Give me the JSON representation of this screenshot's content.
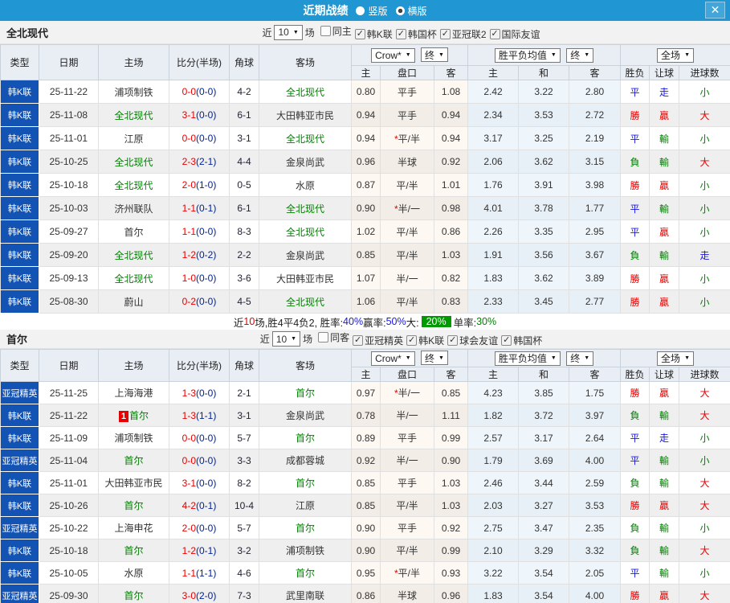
{
  "titlebar": {
    "title": "近期战绩",
    "layout_options": [
      {
        "label": "竖版",
        "selected": false
      },
      {
        "label": "横版",
        "selected": true
      }
    ],
    "close_icon": "✕"
  },
  "colors": {
    "accent_blue": "#2097d3",
    "type_column_blue": "#1353b4",
    "focus_team_green": "#008000",
    "score_red": "#e60000",
    "halftime_navy": "#00239c",
    "badge_green": "#009900"
  },
  "table_header": {
    "type": "类型",
    "date": "日期",
    "home": "主场",
    "score": "比分(半场)",
    "corner": "角球",
    "away": "客场",
    "bookmaker_select": "Crow*",
    "final_select": "终",
    "avg_select": "胜平负均值",
    "final_select2": "终",
    "scope_select": "全场",
    "caret": "▼",
    "sub_headers": [
      "主",
      "盘口",
      "客",
      "主",
      "和",
      "客",
      "胜负",
      "让球",
      "进球数"
    ]
  },
  "result_colors": {
    "勝": "#e60000",
    "贏": "#e60000",
    "大": "#e60000",
    "平": "#1515e6",
    "走": "#1515e6",
    "負": "#008000",
    "輸": "#008000",
    "小": "#008000"
  },
  "sections": [
    {
      "team": "全北现代",
      "filters": {
        "prefix": "近",
        "count": "10",
        "suffix": "场",
        "checkboxes": [
          {
            "label": "同主",
            "checked": false
          },
          {
            "label": "韩K联",
            "checked": true
          },
          {
            "label": "韩国杯",
            "checked": true
          },
          {
            "label": "亚冠联2",
            "checked": true
          },
          {
            "label": "国际友谊",
            "checked": true
          }
        ]
      },
      "rows": [
        {
          "type": "韩K联",
          "date": "25-11-22",
          "home": "浦项制铁",
          "home_focus": false,
          "home_card": "",
          "score": "0-0",
          "half": "(0-0)",
          "corner": "4-2",
          "away": "全北现代",
          "away_focus": true,
          "away_card": "",
          "odds": [
            "0.80",
            "平手",
            "1.08"
          ],
          "star": false,
          "avg": [
            "2.42",
            "3.22",
            "2.80"
          ],
          "results": [
            "平",
            "走",
            "小"
          ]
        },
        {
          "type": "韩K联",
          "date": "25-11-08",
          "home": "全北现代",
          "home_focus": true,
          "home_card": "",
          "score": "3-1",
          "half": "(0-0)",
          "corner": "6-1",
          "away": "大田韩亚市民",
          "away_focus": false,
          "away_card": "",
          "odds": [
            "0.94",
            "平手",
            "0.94"
          ],
          "star": false,
          "avg": [
            "2.34",
            "3.53",
            "2.72"
          ],
          "results": [
            "勝",
            "贏",
            "大"
          ]
        },
        {
          "type": "韩K联",
          "date": "25-11-01",
          "home": "江原",
          "home_focus": false,
          "home_card": "",
          "score": "0-0",
          "half": "(0-0)",
          "corner": "3-1",
          "away": "全北现代",
          "away_focus": true,
          "away_card": "",
          "odds": [
            "0.94",
            "平/半",
            "0.94"
          ],
          "star": true,
          "avg": [
            "3.17",
            "3.25",
            "2.19"
          ],
          "results": [
            "平",
            "輸",
            "小"
          ]
        },
        {
          "type": "韩K联",
          "date": "25-10-25",
          "home": "全北现代",
          "home_focus": true,
          "home_card": "",
          "score": "2-3",
          "half": "(2-1)",
          "corner": "4-4",
          "away": "金泉尚武",
          "away_focus": false,
          "away_card": "",
          "odds": [
            "0.96",
            "半球",
            "0.92"
          ],
          "star": false,
          "avg": [
            "2.06",
            "3.62",
            "3.15"
          ],
          "results": [
            "負",
            "輸",
            "大"
          ]
        },
        {
          "type": "韩K联",
          "date": "25-10-18",
          "home": "全北现代",
          "home_focus": true,
          "home_card": "",
          "score": "2-0",
          "half": "(1-0)",
          "corner": "0-5",
          "away": "水原",
          "away_focus": false,
          "away_card": "",
          "odds": [
            "0.87",
            "平/半",
            "1.01"
          ],
          "star": false,
          "avg": [
            "1.76",
            "3.91",
            "3.98"
          ],
          "results": [
            "勝",
            "贏",
            "小"
          ]
        },
        {
          "type": "韩K联",
          "date": "25-10-03",
          "home": "济州联队",
          "home_focus": false,
          "home_card": "",
          "score": "1-1",
          "half": "(0-1)",
          "corner": "6-1",
          "away": "全北现代",
          "away_focus": true,
          "away_card": "",
          "odds": [
            "0.90",
            "半/一",
            "0.98"
          ],
          "star": true,
          "avg": [
            "4.01",
            "3.78",
            "1.77"
          ],
          "results": [
            "平",
            "輸",
            "小"
          ]
        },
        {
          "type": "韩K联",
          "date": "25-09-27",
          "home": "首尔",
          "home_focus": false,
          "home_card": "",
          "score": "1-1",
          "half": "(0-0)",
          "corner": "8-3",
          "away": "全北现代",
          "away_focus": true,
          "away_card": "",
          "odds": [
            "1.02",
            "平/半",
            "0.86"
          ],
          "star": false,
          "avg": [
            "2.26",
            "3.35",
            "2.95"
          ],
          "results": [
            "平",
            "贏",
            "小"
          ]
        },
        {
          "type": "韩K联",
          "date": "25-09-20",
          "home": "全北现代",
          "home_focus": true,
          "home_card": "",
          "score": "1-2",
          "half": "(0-2)",
          "corner": "2-2",
          "away": "金泉尚武",
          "away_focus": false,
          "away_card": "",
          "odds": [
            "0.85",
            "平/半",
            "1.03"
          ],
          "star": false,
          "avg": [
            "1.91",
            "3.56",
            "3.67"
          ],
          "results": [
            "負",
            "輸",
            "走"
          ]
        },
        {
          "type": "韩K联",
          "date": "25-09-13",
          "home": "全北现代",
          "home_focus": true,
          "home_card": "",
          "score": "1-0",
          "half": "(0-0)",
          "corner": "3-6",
          "away": "大田韩亚市民",
          "away_focus": false,
          "away_card": "",
          "odds": [
            "1.07",
            "半/一",
            "0.82"
          ],
          "star": false,
          "avg": [
            "1.83",
            "3.62",
            "3.89"
          ],
          "results": [
            "勝",
            "贏",
            "小"
          ]
        },
        {
          "type": "韩K联",
          "date": "25-08-30",
          "home": "蔚山",
          "home_focus": false,
          "home_card": "",
          "score": "0-2",
          "half": "(0-0)",
          "corner": "4-5",
          "away": "全北现代",
          "away_focus": true,
          "away_card": "",
          "odds": [
            "1.06",
            "平/半",
            "0.83"
          ],
          "star": false,
          "avg": [
            "2.33",
            "3.45",
            "2.77"
          ],
          "results": [
            "勝",
            "贏",
            "小"
          ]
        }
      ],
      "summary": [
        {
          "t": "近",
          "s": "plain"
        },
        {
          "t": "10",
          "s": "red"
        },
        {
          "t": "场,胜4平4负2, 胜率:",
          "s": "plain"
        },
        {
          "t": "40%",
          "s": "blue"
        },
        {
          "t": " 赢率:",
          "s": "plain"
        },
        {
          "t": "50%",
          "s": "blue"
        },
        {
          "t": " 大:",
          "s": "plain"
        },
        {
          "t": "20%",
          "s": "badge"
        },
        {
          "t": " 单率:",
          "s": "plain"
        },
        {
          "t": "30%",
          "s": "green"
        }
      ]
    },
    {
      "team": "首尔",
      "filters": {
        "prefix": "近",
        "count": "10",
        "suffix": "场",
        "checkboxes": [
          {
            "label": "同客",
            "checked": false
          },
          {
            "label": "亚冠精英",
            "checked": true
          },
          {
            "label": "韩K联",
            "checked": true
          },
          {
            "label": "球会友谊",
            "checked": true
          },
          {
            "label": "韩国杯",
            "checked": true
          }
        ]
      },
      "rows": [
        {
          "type": "亚冠精英",
          "date": "25-11-25",
          "home": "上海海港",
          "home_focus": false,
          "home_card": "",
          "score": "1-3",
          "half": "(0-0)",
          "corner": "2-1",
          "away": "首尔",
          "away_focus": true,
          "away_card": "",
          "odds": [
            "0.97",
            "半/一",
            "0.85"
          ],
          "star": true,
          "avg": [
            "4.23",
            "3.85",
            "1.75"
          ],
          "results": [
            "勝",
            "贏",
            "大"
          ]
        },
        {
          "type": "韩K联",
          "date": "25-11-22",
          "home": "首尔",
          "home_focus": true,
          "home_card": "1",
          "score": "1-3",
          "half": "(1-1)",
          "corner": "3-1",
          "away": "金泉尚武",
          "away_focus": false,
          "away_card": "",
          "odds": [
            "0.78",
            "半/一",
            "1.11"
          ],
          "star": false,
          "avg": [
            "1.82",
            "3.72",
            "3.97"
          ],
          "results": [
            "負",
            "輸",
            "大"
          ]
        },
        {
          "type": "韩K联",
          "date": "25-11-09",
          "home": "浦项制铁",
          "home_focus": false,
          "home_card": "",
          "score": "0-0",
          "half": "(0-0)",
          "corner": "5-7",
          "away": "首尔",
          "away_focus": true,
          "away_card": "",
          "odds": [
            "0.89",
            "平手",
            "0.99"
          ],
          "star": false,
          "avg": [
            "2.57",
            "3.17",
            "2.64"
          ],
          "results": [
            "平",
            "走",
            "小"
          ]
        },
        {
          "type": "亚冠精英",
          "date": "25-11-04",
          "home": "首尔",
          "home_focus": true,
          "home_card": "",
          "score": "0-0",
          "half": "(0-0)",
          "corner": "3-3",
          "away": "成都蓉城",
          "away_focus": false,
          "away_card": "",
          "odds": [
            "0.92",
            "半/一",
            "0.90"
          ],
          "star": false,
          "avg": [
            "1.79",
            "3.69",
            "4.00"
          ],
          "results": [
            "平",
            "輸",
            "小"
          ]
        },
        {
          "type": "韩K联",
          "date": "25-11-01",
          "home": "大田韩亚市民",
          "home_focus": false,
          "home_card": "",
          "score": "3-1",
          "half": "(0-0)",
          "corner": "8-2",
          "away": "首尔",
          "away_focus": true,
          "away_card": "",
          "odds": [
            "0.85",
            "平手",
            "1.03"
          ],
          "star": false,
          "avg": [
            "2.46",
            "3.44",
            "2.59"
          ],
          "results": [
            "負",
            "輸",
            "大"
          ]
        },
        {
          "type": "韩K联",
          "date": "25-10-26",
          "home": "首尔",
          "home_focus": true,
          "home_card": "",
          "score": "4-2",
          "half": "(0-1)",
          "corner": "10-4",
          "away": "江原",
          "away_focus": false,
          "away_card": "",
          "odds": [
            "0.85",
            "平/半",
            "1.03"
          ],
          "star": false,
          "avg": [
            "2.03",
            "3.27",
            "3.53"
          ],
          "results": [
            "勝",
            "贏",
            "大"
          ]
        },
        {
          "type": "亚冠精英",
          "date": "25-10-22",
          "home": "上海申花",
          "home_focus": false,
          "home_card": "",
          "score": "2-0",
          "half": "(0-0)",
          "corner": "5-7",
          "away": "首尔",
          "away_focus": true,
          "away_card": "",
          "odds": [
            "0.90",
            "平手",
            "0.92"
          ],
          "star": false,
          "avg": [
            "2.75",
            "3.47",
            "2.35"
          ],
          "results": [
            "負",
            "輸",
            "小"
          ]
        },
        {
          "type": "韩K联",
          "date": "25-10-18",
          "home": "首尔",
          "home_focus": true,
          "home_card": "",
          "score": "1-2",
          "half": "(0-1)",
          "corner": "3-2",
          "away": "浦项制铁",
          "away_focus": false,
          "away_card": "",
          "odds": [
            "0.90",
            "平/半",
            "0.99"
          ],
          "star": false,
          "avg": [
            "2.10",
            "3.29",
            "3.32"
          ],
          "results": [
            "負",
            "輸",
            "大"
          ]
        },
        {
          "type": "韩K联",
          "date": "25-10-05",
          "home": "水原",
          "home_focus": false,
          "home_card": "",
          "score": "1-1",
          "half": "(1-1)",
          "corner": "4-6",
          "away": "首尔",
          "away_focus": true,
          "away_card": "",
          "odds": [
            "0.95",
            "平/半",
            "0.93"
          ],
          "star": true,
          "avg": [
            "3.22",
            "3.54",
            "2.05"
          ],
          "results": [
            "平",
            "輸",
            "小"
          ]
        },
        {
          "type": "亚冠精英",
          "date": "25-09-30",
          "home": "首尔",
          "home_focus": true,
          "home_card": "",
          "score": "3-0",
          "half": "(2-0)",
          "corner": "7-3",
          "away": "武里南联",
          "away_focus": false,
          "away_card": "",
          "odds": [
            "0.86",
            "半球",
            "0.96"
          ],
          "star": false,
          "avg": [
            "1.83",
            "3.54",
            "4.00"
          ],
          "results": [
            "勝",
            "贏",
            "大"
          ]
        }
      ],
      "summary": null
    }
  ]
}
